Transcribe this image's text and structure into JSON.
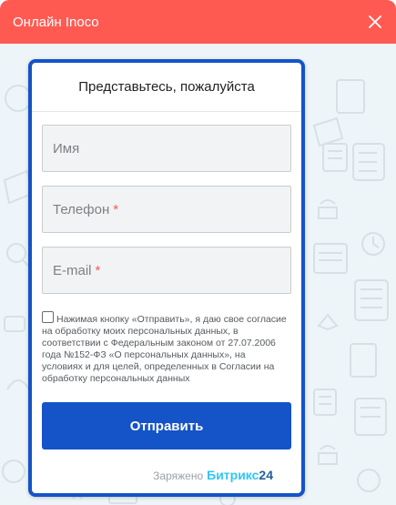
{
  "header": {
    "title": "Онлайн Inoco",
    "close_icon": "close-icon"
  },
  "form": {
    "heading": "Представьтесь, пожалуйста",
    "fields": [
      {
        "placeholder": "Имя",
        "required": false
      },
      {
        "placeholder": "Телефон",
        "required": true,
        "required_mark": "*"
      },
      {
        "placeholder": "E-mail",
        "required": true,
        "required_mark": "*"
      }
    ],
    "consent_text": "Нажимая кнопку «Отправить», я даю свое согласие на обработку моих персональных данных, в соответствии с Федеральным законом от 27.07.2006 года №152-ФЗ «О персональных данных», на условиях и для целей, определенных в Согласии на обработку персональных данных",
    "submit_label": "Отправить"
  },
  "footer": {
    "powered_label": "Заряжено",
    "brand_name": "Битрикс",
    "brand_number": "24"
  },
  "colors": {
    "header": "#ff5a52",
    "accent": "#1453c8",
    "required": "#ff5752",
    "brand": "#2fc6f6"
  }
}
